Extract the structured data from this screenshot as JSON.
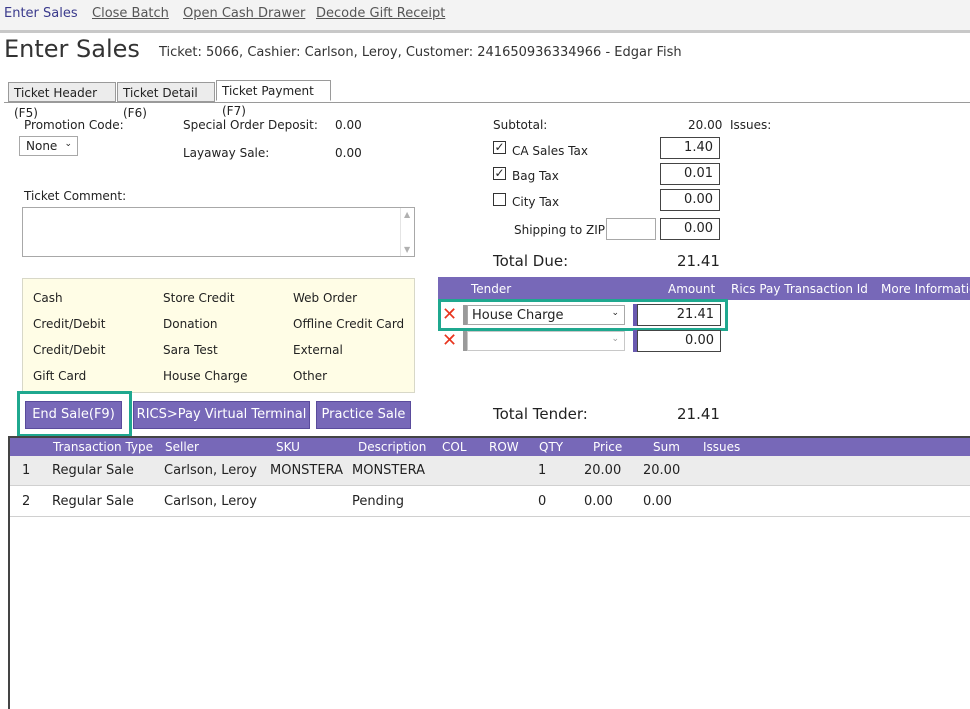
{
  "nav": [
    "Enter Sales",
    "Close Batch",
    "Open Cash Drawer",
    "Decode Gift Receipt"
  ],
  "page_title": "Enter Sales",
  "ticket_info": "Ticket: 5066, Cashier: Carlson, Leroy, Customer: 241650936334966 - Edgar Fish",
  "tabs": [
    "Ticket Header (F5)",
    "Ticket Detail (F6)",
    "Ticket Payment (F7)"
  ],
  "left": {
    "promo_label": "Promotion Code:",
    "promo_value": "None",
    "sod_label": "Special Order Deposit:",
    "sod_value": "0.00",
    "layaway_label": "Layaway Sale:",
    "layaway_value": "0.00",
    "comment_label": "Ticket Comment:"
  },
  "payment_options": [
    [
      "Cash",
      "Store Credit",
      "Web Order"
    ],
    [
      "Credit/Debit",
      "Donation",
      "Offline Credit Card"
    ],
    [
      "Credit/Debit",
      "Sara Test",
      "External"
    ],
    [
      "Gift Card",
      "House Charge",
      "Other"
    ]
  ],
  "buttons": {
    "end_sale": "End Sale(F9)",
    "rics_pay": "RICS>Pay Virtual Terminal",
    "practice": "Practice Sale"
  },
  "summary": {
    "subtotal_label": "Subtotal:",
    "subtotal_value": "20.00",
    "issues_label": "Issues:",
    "ca_tax_label": "CA Sales Tax",
    "ca_tax_value": "1.40",
    "ca_tax_checked": true,
    "bag_tax_label": "Bag Tax",
    "bag_tax_value": "0.01",
    "bag_tax_checked": true,
    "city_tax_label": "City Tax",
    "city_tax_value": "0.00",
    "city_tax_checked": false,
    "shipping_label": "Shipping to ZIP:",
    "shipping_zip": "",
    "shipping_value": "0.00",
    "total_due_label": "Total Due:",
    "total_due_value": "21.41",
    "total_tender_label": "Total Tender:",
    "total_tender_value": "21.41"
  },
  "tender_table": {
    "headers": [
      "Tender",
      "Amount",
      "Rics Pay Transaction Id",
      "More Information"
    ],
    "rows": [
      {
        "tender": "House Charge",
        "amount": "21.41"
      },
      {
        "tender": "",
        "amount": "0.00"
      }
    ]
  },
  "grid": {
    "headers": [
      "Transaction Type",
      "Seller",
      "SKU",
      "Description",
      "COL",
      "ROW",
      "QTY",
      "Price",
      "Sum",
      "Issues"
    ],
    "rows": [
      {
        "num": "1",
        "type": "Regular Sale",
        "seller": "Carlson, Leroy",
        "sku": "MONSTERA",
        "desc": "MONSTERA",
        "qty": "1",
        "price": "20.00",
        "sum": "20.00"
      },
      {
        "num": "2",
        "type": "Regular Sale",
        "seller": "Carlson, Leroy",
        "sku": "",
        "desc": "Pending",
        "qty": "0",
        "price": "0.00",
        "sum": "0.00"
      }
    ]
  },
  "colors": {
    "accent": "#7768b8",
    "highlight": "#1fa88f",
    "remove": "#e8351e",
    "payment_bg": "#fffde6"
  }
}
